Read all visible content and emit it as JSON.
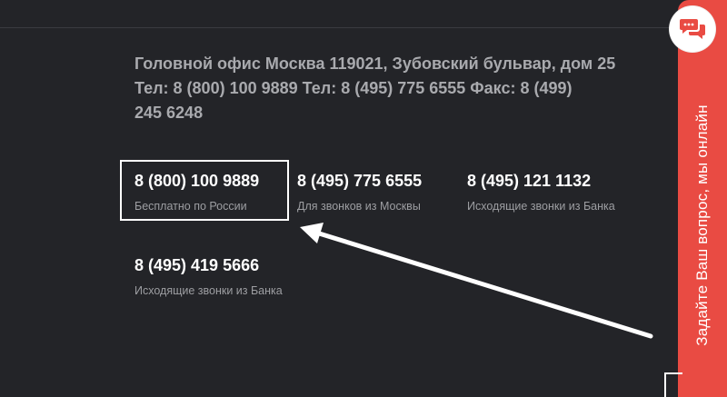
{
  "contacts": {
    "address_line1": "Головной офис Москва 119021, Зубовский бульвар, дом 25",
    "address_line2": "Тел: 8 (800) 100 9889 Тел: 8 (495) 775 6555 Факс: 8 (499)",
    "address_line3": "245 6248",
    "phones": [
      {
        "number": "8 (800) 100 9889",
        "caption": "Бесплатно по России"
      },
      {
        "number": "8 (495) 775 6555",
        "caption": "Для звонков из Москвы"
      },
      {
        "number": "8 (495) 121 1132",
        "caption": "Исходящие звонки из Банка"
      },
      {
        "number": "8 (495) 419 5666",
        "caption": "Исходящие звонки из Банка"
      }
    ]
  },
  "chat_widget": {
    "label": "Задайте Ваш вопрос, мы онлайн",
    "icon": "chat-bubbles-icon"
  },
  "colors": {
    "background": "#232428",
    "accent": "#e94b43",
    "text_primary": "#ffffff",
    "text_muted": "#9d9ea2"
  }
}
